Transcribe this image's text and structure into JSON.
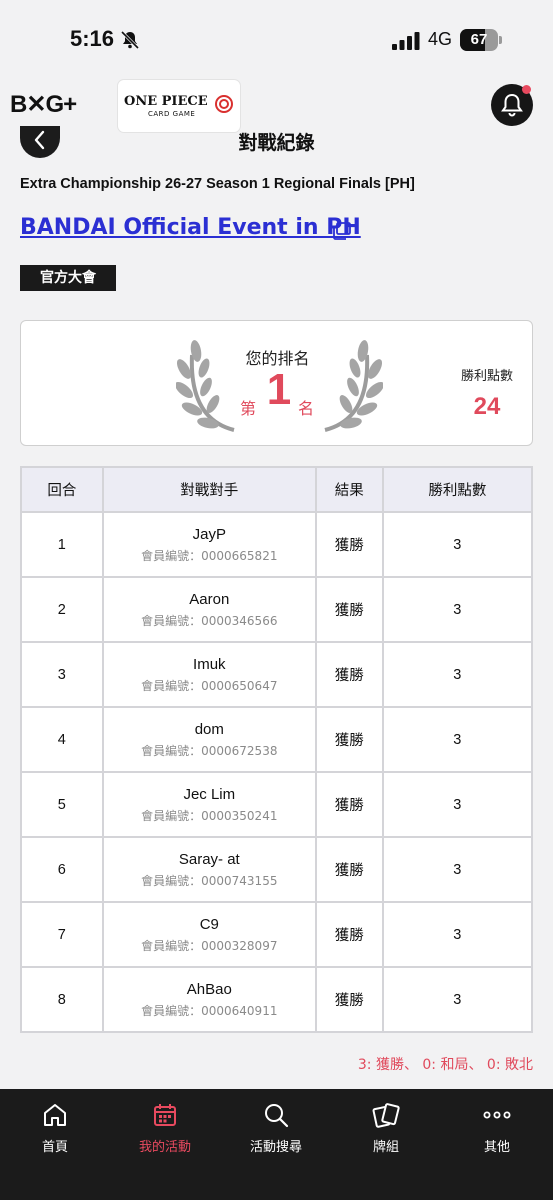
{
  "status_bar": {
    "time": "5:16",
    "network": "4G",
    "battery": "67",
    "battery_level": 0.67
  },
  "header": {
    "logo_left": "B✕G+",
    "logo_center_title": "ONE PIECE",
    "logo_center_sub": "CARD GAME",
    "notification_icon": "bell-icon"
  },
  "page": {
    "title": "對戰紀錄",
    "event_name": "Extra Championship 26-27 Season 1 Regional Finals [PH]",
    "event_link": "BANDAI Official Event in PH",
    "badge": "官方大會"
  },
  "rank_card": {
    "rank_label": "您的排名",
    "rank_prefix": "第",
    "rank_value": "1",
    "rank_suffix": "名",
    "win_points_label": "勝利點數",
    "win_points_value": "24",
    "accent_color": "#e04a5c"
  },
  "table": {
    "headers": [
      "回合",
      "對戰對手",
      "結果",
      "勝利點數"
    ],
    "rows": [
      {
        "round": "1",
        "name": "JayP",
        "member": "會員編號：0000665821",
        "result": "獲勝",
        "points": "3"
      },
      {
        "round": "2",
        "name": "Aaron",
        "member": "會員編號：0000346566",
        "result": "獲勝",
        "points": "3"
      },
      {
        "round": "3",
        "name": "Imuk",
        "member": "會員編號：0000650647",
        "result": "獲勝",
        "points": "3"
      },
      {
        "round": "4",
        "name": "dom",
        "member": "會員編號：0000672538",
        "result": "獲勝",
        "points": "3"
      },
      {
        "round": "5",
        "name": "Jec Lim",
        "member": "會員編號：0000350241",
        "result": "獲勝",
        "points": "3"
      },
      {
        "round": "6",
        "name": "Saray- at",
        "member": "會員編號：0000743155",
        "result": "獲勝",
        "points": "3"
      },
      {
        "round": "7",
        "name": "C9",
        "member": "會員編號：0000328097",
        "result": "獲勝",
        "points": "3"
      },
      {
        "round": "8",
        "name": "AhBao",
        "member": "會員編號：0000640911",
        "result": "獲勝",
        "points": "3"
      }
    ]
  },
  "legend": "3: 獲勝、 0: 和局、 0: 敗北",
  "bottom_nav": [
    {
      "label": "首頁",
      "icon": "home-icon",
      "active": false
    },
    {
      "label": "我的活動",
      "icon": "calendar-icon",
      "active": true
    },
    {
      "label": "活動搜尋",
      "icon": "search-icon",
      "active": false
    },
    {
      "label": "牌組",
      "icon": "cards-icon",
      "active": false
    },
    {
      "label": "其他",
      "icon": "more-icon",
      "active": false
    }
  ]
}
